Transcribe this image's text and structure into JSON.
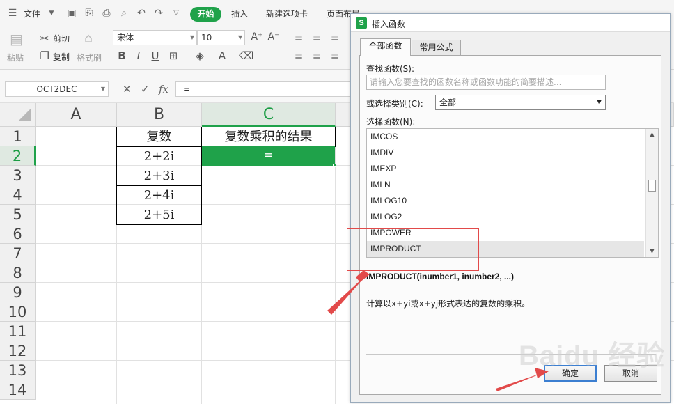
{
  "menubar": {
    "file": "文件",
    "tabs": [
      "开始",
      "插入",
      "新建选项卡",
      "页面布局"
    ],
    "active_tab": "开始"
  },
  "ribbon": {
    "paste": "粘贴",
    "cut": "剪切",
    "copy": "复制",
    "format_painter": "格式刷",
    "font_name": "宋体",
    "font_size": "10"
  },
  "formula_bar": {
    "name_box": "OCT2DEC",
    "fx": "fx",
    "formula": "="
  },
  "sheet": {
    "columns": [
      "A",
      "B",
      "C"
    ],
    "rows": [
      "1",
      "2",
      "3",
      "4",
      "5",
      "6",
      "7",
      "8",
      "9",
      "10",
      "11",
      "12",
      "13",
      "14"
    ],
    "b1": "复数",
    "c1": "复数乘积的结果",
    "b2": "2+2i",
    "b3": "2+3i",
    "b4": "2+4i",
    "b5": "2+5i",
    "c2": "="
  },
  "dialog": {
    "title": "插入函数",
    "tab_all": "全部函数",
    "tab_common": "常用公式",
    "search_label": "查找函数(S):",
    "search_placeholder": "请输入您要查找的函数名称或函数功能的简要描述...",
    "category_label": "或选择类别(C):",
    "category_value": "全部",
    "list_label": "选择函数(N):",
    "functions": [
      "IMCOS",
      "IMDIV",
      "IMEXP",
      "IMLN",
      "IMLOG10",
      "IMLOG2",
      "IMPOWER",
      "IMPRODUCT"
    ],
    "selected_function": "IMPRODUCT",
    "signature": "IMPRODUCT(inumber1, inumber2, ...)",
    "description": "计算以x+yi或x+yj形式表达的复数的乘积。",
    "ok": "确定",
    "cancel": "取消"
  },
  "watermark": "Baidu 经验",
  "colors": {
    "accent_green": "#1fa24a",
    "annotation_red": "#e24a4a",
    "primary_button_border": "#3c7fd1"
  }
}
